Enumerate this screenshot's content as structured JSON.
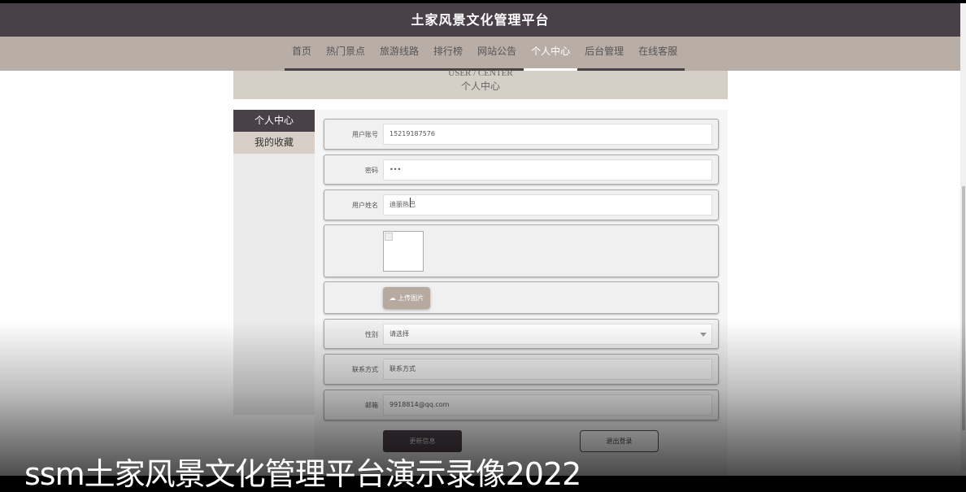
{
  "header": {
    "title": "土家风景文化管理平台"
  },
  "nav": {
    "items": [
      "首页",
      "热门景点",
      "旅游线路",
      "排行榜",
      "网站公告",
      "个人中心",
      "后台管理",
      "在线客服"
    ],
    "active_index": 5
  },
  "banner": {
    "en": "USER / CENTER",
    "cn": "个人中心"
  },
  "sidebar": {
    "items": [
      {
        "label": "个人中心",
        "active": true
      },
      {
        "label": "我的收藏",
        "active": false
      }
    ]
  },
  "form": {
    "account": {
      "label": "用户账号",
      "value": "15219187576"
    },
    "password": {
      "label": "密码",
      "value": "•••"
    },
    "name": {
      "label": "用户姓名",
      "value": "迪丽热巴"
    },
    "upload_label": "上传图片",
    "gender": {
      "label": "性别",
      "value": "请选择"
    },
    "contact": {
      "label": "联系方式",
      "placeholder": "联系方式"
    },
    "email": {
      "label": "邮箱",
      "value": "9918814@qq.com"
    },
    "update_button": "更新信息",
    "logout_button": "退出登录"
  },
  "caption": "ssm土家风景文化管理平台演示录像2022",
  "colors": {
    "header_bg": "#4a4048",
    "nav_bg": "#b9aea6",
    "banner_bg": "#d6cfc8",
    "accent_button": "#4a4048",
    "upload_button": "#b5a9a0"
  }
}
